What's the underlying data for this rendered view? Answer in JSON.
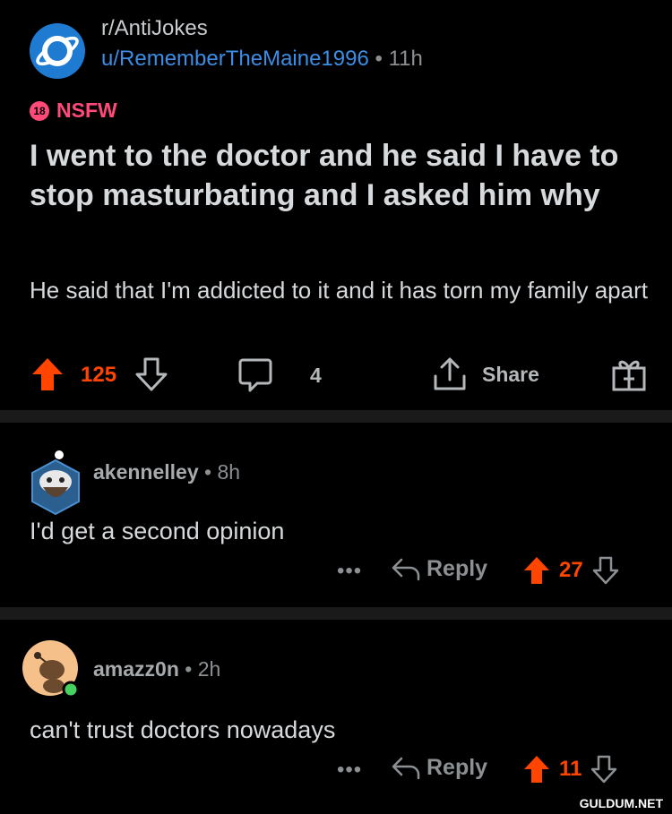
{
  "post": {
    "subreddit": "r/AntiJokes",
    "author": "u/RememberTheMaine1996",
    "separator": "•",
    "time": "11h",
    "nsfw_badge": "18",
    "nsfw_label": "NSFW",
    "title": "I went to the doctor and he said I have to stop masturbating and I asked him why",
    "body": "He said that I'm addicted to it and it has torn my family apart",
    "upvotes": "125",
    "comments": "4",
    "share_label": "Share"
  },
  "comments": [
    {
      "username": "akennelley",
      "separator": "•",
      "time": "8h",
      "text": "I'd get a second opinion",
      "more": "•••",
      "reply_label": "Reply",
      "votes": "27"
    },
    {
      "username": "amazz0n",
      "separator": "•",
      "time": "2h",
      "text": "can't trust doctors nowadays",
      "more": "•••",
      "reply_label": "Reply",
      "votes": "11"
    }
  ],
  "watermark": "GULDUM.NET",
  "colors": {
    "upvote": "#ff4500",
    "link": "#3a8ee6",
    "nsfw": "#ff4a7a",
    "background": "#000000",
    "divider": "#1a1a1b"
  }
}
